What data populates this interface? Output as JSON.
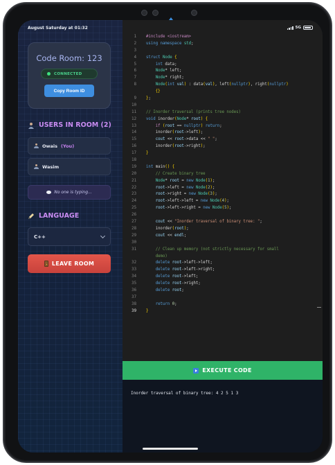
{
  "status_bar": {
    "time": "August Saturday at 01:32",
    "network": "5G"
  },
  "room": {
    "title": "Code Room: 123",
    "connection_status": "CONNECTED",
    "copy_button_label": "Copy Room ID"
  },
  "users": {
    "heading": "USERS IN ROOM (2)",
    "list": [
      {
        "name": "Owais",
        "tag": "(You)"
      },
      {
        "name": "Wasim",
        "tag": ""
      }
    ],
    "typing_status": "No one is typing..."
  },
  "language": {
    "heading": "LANGUAGE",
    "selected": "C++"
  },
  "leave_button_label": "LEAVE ROOM",
  "editor": {
    "active_line": "39",
    "lines": [
      {
        "n": "1",
        "text": "#include <iostream>"
      },
      {
        "n": "2",
        "text": "using namespace std;"
      },
      {
        "n": "3",
        "text": ""
      },
      {
        "n": "4",
        "text": "struct Node {"
      },
      {
        "n": "5",
        "text": "    int data;"
      },
      {
        "n": "6",
        "text": "    Node* left;"
      },
      {
        "n": "7",
        "text": "    Node* right;"
      },
      {
        "n": "8",
        "text": "    Node(int val) : data(val), left(nullptr), right(nullptr)"
      },
      {
        "n": "",
        "text": "    {}"
      },
      {
        "n": "9",
        "text": "};"
      },
      {
        "n": "10",
        "text": ""
      },
      {
        "n": "11",
        "text": "// Inorder traversal (prints tree nodes)"
      },
      {
        "n": "12",
        "text": "void inorder(Node* root) {"
      },
      {
        "n": "13",
        "text": "    if (root == nullptr) return;"
      },
      {
        "n": "14",
        "text": "    inorder(root->left);"
      },
      {
        "n": "15",
        "text": "    cout << root->data << \" \";"
      },
      {
        "n": "16",
        "text": "    inorder(root->right);"
      },
      {
        "n": "17",
        "text": "}"
      },
      {
        "n": "18",
        "text": ""
      },
      {
        "n": "19",
        "text": "int main() {"
      },
      {
        "n": "20",
        "text": "    // Create binary tree"
      },
      {
        "n": "21",
        "text": "    Node* root = new Node(1);"
      },
      {
        "n": "22",
        "text": "    root->left = new Node(2);"
      },
      {
        "n": "23",
        "text": "    root->right = new Node(3);"
      },
      {
        "n": "24",
        "text": "    root->left->left = new Node(4);"
      },
      {
        "n": "25",
        "text": "    root->left->right = new Node(5);"
      },
      {
        "n": "26",
        "text": ""
      },
      {
        "n": "27",
        "text": "    cout << \"Inorder traversal of binary tree: \";"
      },
      {
        "n": "28",
        "text": "    inorder(root);"
      },
      {
        "n": "29",
        "text": "    cout << endl;"
      },
      {
        "n": "30",
        "text": ""
      },
      {
        "n": "31",
        "text": "    // Clean up memory (not strictly necessary for small"
      },
      {
        "n": "",
        "text": "    demo)"
      },
      {
        "n": "32",
        "text": "    delete root->left->left;"
      },
      {
        "n": "33",
        "text": "    delete root->left->right;"
      },
      {
        "n": "34",
        "text": "    delete root->left;"
      },
      {
        "n": "35",
        "text": "    delete root->right;"
      },
      {
        "n": "36",
        "text": "    delete root;"
      },
      {
        "n": "37",
        "text": ""
      },
      {
        "n": "38",
        "text": "    return 0;"
      },
      {
        "n": "39",
        "text": "}"
      }
    ]
  },
  "execute_button_label": "EXECUTE CODE",
  "output_text": "Inorder traversal of binary tree: 4 2 5 1 3",
  "colors": {
    "accent_purple": "#c98cf2",
    "connected_green": "#3ee07e",
    "copy_blue": "#3e8ee0",
    "leave_red": "#d94b42",
    "execute_green": "#2fb368"
  }
}
